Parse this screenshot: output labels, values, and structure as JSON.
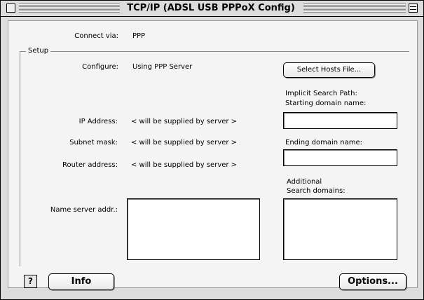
{
  "window": {
    "title": "TCP/IP (ADSL USB PPPoX Config)"
  },
  "connect": {
    "label": "Connect via:",
    "value": "PPP"
  },
  "setup": {
    "group_label": "Setup",
    "configure_label": "Configure:",
    "configure_value": "Using PPP Server",
    "select_hosts_label": "Select Hosts File...",
    "ip_label": "IP Address:",
    "ip_value": "< will be supplied by server >",
    "subnet_label": "Subnet mask:",
    "subnet_value": "< will be supplied by server >",
    "router_label": "Router address:",
    "router_value": "< will be supplied by server >",
    "name_server_label": "Name server addr.:",
    "name_server_value": "",
    "implicit_label": "Implicit Search Path:",
    "starting_label": "Starting domain name:",
    "starting_value": "",
    "ending_label": "Ending domain name:",
    "ending_value": "",
    "additional_label": "Additional",
    "search_domains_label": "Search domains:",
    "search_domains_value": ""
  },
  "footer": {
    "help_label": "?",
    "info_label": "Info",
    "options_label": "Options..."
  },
  "icons": [
    "close-box-icon",
    "zoom-box-icon",
    "help-icon"
  ]
}
